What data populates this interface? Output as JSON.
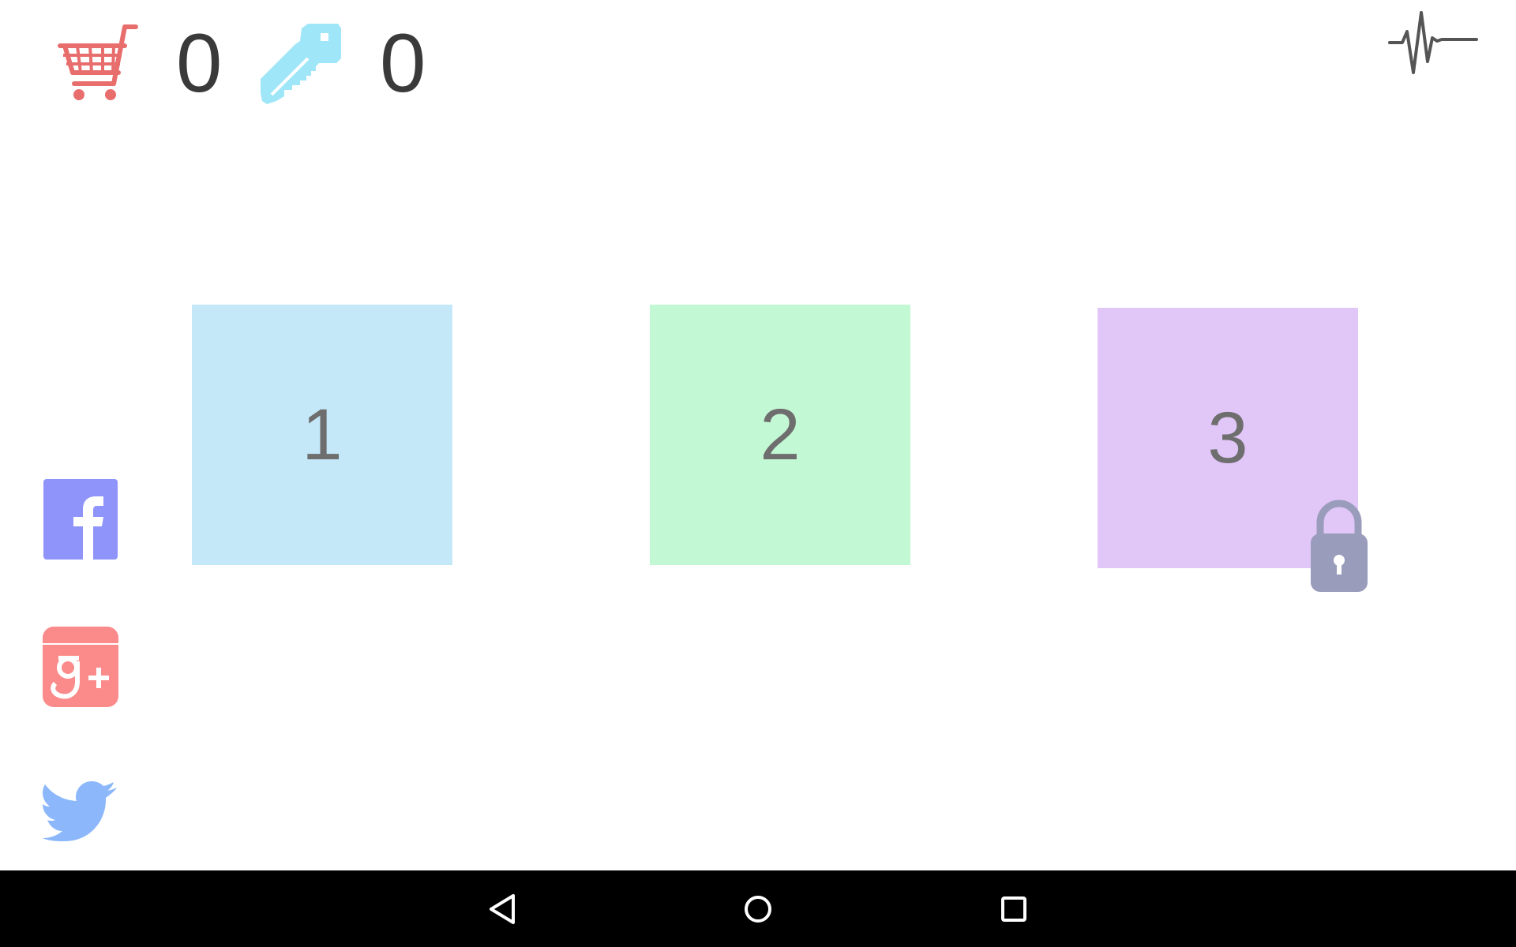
{
  "counters": {
    "cart": {
      "icon": "shopping-cart-icon",
      "value": "0"
    },
    "keys": {
      "icon": "key-icon",
      "value": "0"
    }
  },
  "levels": [
    {
      "label": "1",
      "color": "#c4e8f8",
      "locked": false
    },
    {
      "label": "2",
      "color": "#c3f8d4",
      "locked": false
    },
    {
      "label": "3",
      "color": "#e1c6f8",
      "locked": true
    }
  ],
  "social": [
    {
      "name": "facebook",
      "icon": "facebook-icon",
      "color": "#8f94fb"
    },
    {
      "name": "google-plus",
      "icon": "google-plus-icon",
      "color": "#fb8a8a"
    },
    {
      "name": "twitter",
      "icon": "twitter-icon",
      "color": "#8cb8fb"
    }
  ],
  "top_right_icon": "pulse-icon",
  "navbar": {
    "buttons": [
      "back-icon",
      "home-icon",
      "recents-icon"
    ]
  },
  "colors": {
    "cart": "#e86e6e",
    "key": "#9ee6f8",
    "lock": "#9a9cbc",
    "counter_text": "#3a3a3a",
    "level_text": "#6e6e6e",
    "navbar": "#000000"
  }
}
